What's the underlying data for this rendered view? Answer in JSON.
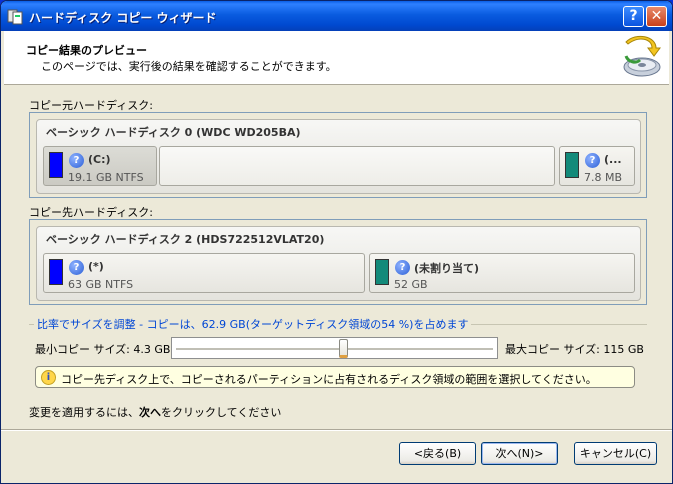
{
  "window": {
    "title": "ハードディスク コピー ウィザード",
    "help_btn": "?",
    "close_btn": "✕"
  },
  "header": {
    "title": "コピー結果のプレビュー",
    "subtitle": "このページでは、実行後の結果を確認することができます。"
  },
  "source": {
    "label": "コピー元ハードディスク:",
    "disk_name": "ベーシック ハードディスク 0 (WDC WD205BA)",
    "partitions": [
      {
        "label": "(C:)",
        "size": "19.1 GB NTFS",
        "color": "#0000ff",
        "selected": true
      },
      {
        "label": "(...",
        "size": "7.8 MB",
        "color": "#138a7a",
        "selected": false
      }
    ]
  },
  "target": {
    "label": "コピー先ハードディスク:",
    "disk_name": "ベーシック ハードディスク 2 (HDS722512VLAT20)",
    "partitions": [
      {
        "label": "(*)",
        "size": "63 GB NTFS",
        "color": "#0000ff"
      },
      {
        "label": "(未割り当て)",
        "size": "52 GB",
        "color": "#138a7a"
      }
    ]
  },
  "resize": {
    "legend": "比率でサイズを調整 - コピーは、62.9 GB(ターゲットディスク領域の54 %)を占めます",
    "min_label": "最小コピー サイズ: 4.3 GB",
    "max_label": "最大コピー サイズ: 115 GB",
    "info": "コピー先ディスク上で、コピーされるパーティションに占有されるディスク領域の範囲を選択してください。"
  },
  "footer": {
    "note_prefix": "変更を適用するには、",
    "note_bold": "次へ",
    "note_suffix": "をクリックしてください"
  },
  "buttons": {
    "back": "<戻る(B)",
    "next": "次へ(N)>",
    "cancel": "キャンセル(C)"
  },
  "colors": {
    "titlebar": "#0a5ce0",
    "legend": "#0046d5"
  }
}
